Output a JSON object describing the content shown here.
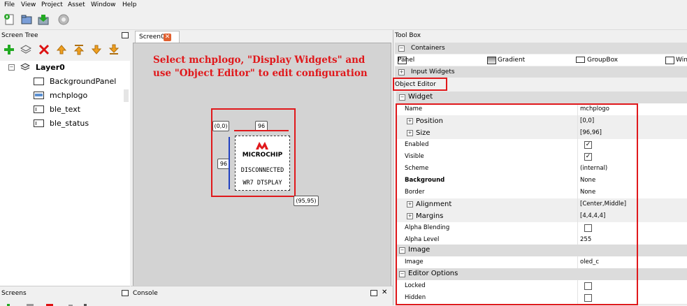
{
  "menu": {
    "file": "File",
    "view": "View",
    "project": "Project",
    "asset": "Asset",
    "window": "Window",
    "help": "Help"
  },
  "left_panel": {
    "title": "Screen Tree",
    "tree": {
      "layer": "Layer0",
      "items": [
        "BackgroundPanel",
        "mchplogo",
        "ble_text",
        "ble_status"
      ]
    }
  },
  "screens_panel": {
    "title": "Screens"
  },
  "center": {
    "tab_label": "Screen0",
    "instruction": "Select mchplogo, \"Display Widgets\" and use \"Object Editor\" to edit configuration",
    "widget": {
      "origin": "(0,0)",
      "width": "96",
      "height": "96",
      "end": "(95,95)",
      "logo_text": "MICROCHIP",
      "line1": "DISCONNECTED",
      "line2": "WR7 DTSPLAY"
    }
  },
  "console_panel": {
    "title": "Console"
  },
  "toolbox": {
    "title": "Tool Box",
    "containers_header": "Containers",
    "items": [
      "Panel",
      "Gradient",
      "GroupBox",
      "Win"
    ],
    "input_widgets_header": "Input Widgets"
  },
  "object_editor": {
    "title": "Object Editor",
    "sections": {
      "widget": "Widget",
      "image": "Image",
      "editor_options": "Editor Options"
    },
    "rows": {
      "name": {
        "label": "Name",
        "value": "mchplogo"
      },
      "position": {
        "label": "Position",
        "value": "[0,0]"
      },
      "size": {
        "label": "Size",
        "value": "[96,96]"
      },
      "enabled": {
        "label": "Enabled",
        "checked": true
      },
      "visible": {
        "label": "Visible",
        "checked": true
      },
      "scheme": {
        "label": "Scheme",
        "value": "(internal)"
      },
      "background": {
        "label": "Background",
        "value": "None"
      },
      "border": {
        "label": "Border",
        "value": "None"
      },
      "alignment": {
        "label": "Alignment",
        "value": "[Center,Middle]"
      },
      "margins": {
        "label": "Margins",
        "value": "[4,4,4,4]"
      },
      "alpha_blending": {
        "label": "Alpha Blending",
        "checked": false
      },
      "alpha_level": {
        "label": "Alpha Level",
        "value": "255"
      },
      "image": {
        "label": "Image",
        "value": "oled_c"
      },
      "locked": {
        "label": "Locked",
        "checked": false
      },
      "hidden": {
        "label": "Hidden",
        "checked": false
      }
    }
  },
  "colors": {
    "annotation_red": "#e0181b",
    "selection_blue": "#2040c0"
  }
}
